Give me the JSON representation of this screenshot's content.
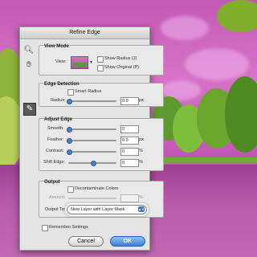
{
  "dialog": {
    "title": "Refine Edge",
    "view_mode": {
      "title": "View Mode",
      "view_label": "View:",
      "show_radius": "Show Radius (J)",
      "show_original": "Show Original (P)"
    },
    "edge_detection": {
      "title": "Edge Detection",
      "smart_radius": "Smart Radius",
      "radius_label": "Radius:",
      "radius_value": "0.0",
      "radius_unit": "px"
    },
    "adjust_edge": {
      "title": "Adjust Edge",
      "smooth_label": "Smooth:",
      "smooth_value": "0",
      "feather_label": "Feather:",
      "feather_value": "0.0",
      "feather_unit": "px",
      "contrast_label": "Contrast:",
      "contrast_value": "0",
      "contrast_unit": "%",
      "shift_label": "Shift Edge:",
      "shift_value": "0",
      "shift_unit": "%"
    },
    "output": {
      "title": "Output",
      "decontaminate": "Decontaminate Colors",
      "amount_label": "Amount:",
      "amount_unit": "%",
      "output_to_label": "Output To:",
      "output_to_value": "New Layer with Layer Mask"
    },
    "remember": "Remember Settings",
    "cancel": "Cancel",
    "ok": "OK"
  }
}
